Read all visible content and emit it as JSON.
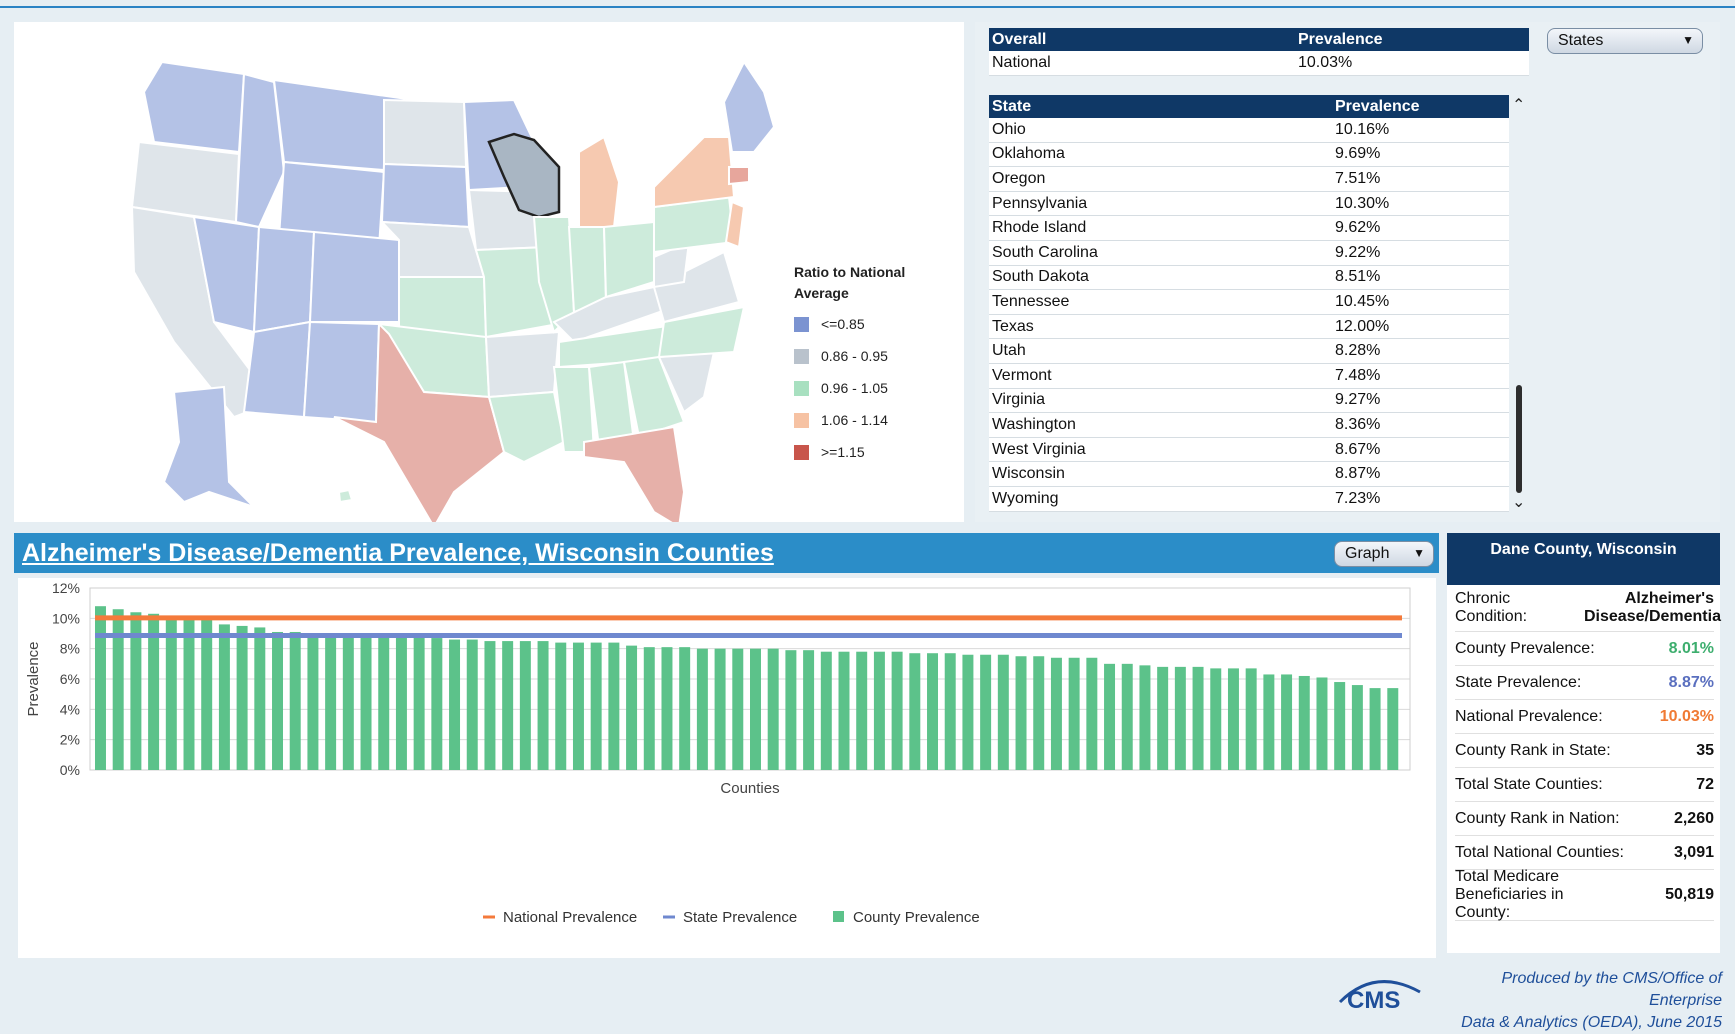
{
  "map": {
    "legend_title_line1": "Ratio to National",
    "legend_title_line2": "Average",
    "legend": [
      {
        "label": "<=0.85",
        "color": "#7b93d1"
      },
      {
        "label": "0.86 - 0.95",
        "color": "#b9c2cc"
      },
      {
        "label": "0.96 - 1.05",
        "color": "#a8e0c0"
      },
      {
        "label": "1.06 - 1.14",
        "color": "#f6c2a3"
      },
      {
        "label": ">=1.15",
        "color": "#c8554b"
      }
    ]
  },
  "overall_table": {
    "col1": "Overall",
    "col2": "Prevalence",
    "row_label": "National",
    "row_value": "10.03%"
  },
  "states_dropdown": "States",
  "state_table": {
    "col1": "State",
    "col2": "Prevalence",
    "rows": [
      {
        "state": "Ohio",
        "value": "10.16%"
      },
      {
        "state": "Oklahoma",
        "value": "9.69%"
      },
      {
        "state": "Oregon",
        "value": "7.51%"
      },
      {
        "state": "Pennsylvania",
        "value": "10.30%"
      },
      {
        "state": "Rhode Island",
        "value": "9.62%"
      },
      {
        "state": "South Carolina",
        "value": "9.22%"
      },
      {
        "state": "South Dakota",
        "value": "8.51%"
      },
      {
        "state": "Tennessee",
        "value": "10.45%"
      },
      {
        "state": "Texas",
        "value": "12.00%"
      },
      {
        "state": "Utah",
        "value": "8.28%"
      },
      {
        "state": "Vermont",
        "value": "7.48%"
      },
      {
        "state": "Virginia",
        "value": "9.27%"
      },
      {
        "state": "Washington",
        "value": "8.36%"
      },
      {
        "state": "West Virginia",
        "value": "8.67%"
      },
      {
        "state": "Wisconsin",
        "value": "8.87%"
      },
      {
        "state": "Wyoming",
        "value": "7.23%"
      }
    ]
  },
  "chart_header": {
    "title": "Alzheimer's Disease/Dementia Prevalence, Wisconsin Counties",
    "graph_dropdown": "Graph"
  },
  "chart_data": {
    "type": "bar",
    "xlabel": "Counties",
    "ylabel": "Prevalence",
    "ylim": [
      0,
      12
    ],
    "yticks": [
      "0%",
      "2%",
      "4%",
      "6%",
      "8%",
      "10%",
      "12%"
    ],
    "grid": true,
    "legend_position": "bottom",
    "series": [
      {
        "name": "County Prevalence",
        "type": "bar",
        "color": "#5cc28a",
        "values": [
          10.8,
          10.6,
          10.4,
          10.3,
          10.0,
          9.9,
          9.9,
          9.6,
          9.5,
          9.4,
          9.1,
          9.1,
          9.0,
          8.9,
          8.9,
          8.9,
          8.8,
          8.8,
          8.8,
          8.7,
          8.6,
          8.6,
          8.5,
          8.5,
          8.5,
          8.5,
          8.4,
          8.4,
          8.4,
          8.4,
          8.2,
          8.1,
          8.1,
          8.1,
          8.0,
          8.0,
          8.0,
          8.0,
          8.0,
          7.9,
          7.9,
          7.8,
          7.8,
          7.8,
          7.8,
          7.8,
          7.7,
          7.7,
          7.7,
          7.6,
          7.6,
          7.6,
          7.5,
          7.5,
          7.4,
          7.4,
          7.4,
          7.0,
          7.0,
          6.9,
          6.8,
          6.8,
          6.8,
          6.7,
          6.7,
          6.7,
          6.3,
          6.3,
          6.2,
          6.1,
          5.8,
          5.6,
          5.4,
          5.4
        ]
      },
      {
        "name": "National Prevalence",
        "type": "line",
        "color": "#f47a3b",
        "value": 10.03
      },
      {
        "name": "State Prevalence",
        "type": "line",
        "color": "#6f88cf",
        "value": 8.87
      }
    ]
  },
  "county_info": {
    "title": "Dane County, Wisconsin",
    "rows": [
      {
        "label": "Chronic Condition:",
        "value": "Alzheimer's Disease/Dementia",
        "color": "#111111"
      },
      {
        "label": "County Prevalence:",
        "value": "8.01%",
        "color": "#3dae6e"
      },
      {
        "label": "State Prevalence:",
        "value": "8.87%",
        "color": "#5a6fbf"
      },
      {
        "label": "National Prevalence:",
        "value": "10.03%",
        "color": "#f07a34"
      },
      {
        "label": "County Rank in State:",
        "value": "35",
        "color": "#111111"
      },
      {
        "label": "Total State Counties:",
        "value": "72",
        "color": "#111111"
      },
      {
        "label": "County Rank in Nation:",
        "value": "2,260",
        "color": "#111111"
      },
      {
        "label": "Total National Counties:",
        "value": "3,091",
        "color": "#111111"
      },
      {
        "label": "Total Medicare Beneficiaries in County:",
        "value": "50,819",
        "color": "#111111"
      }
    ]
  },
  "footer": {
    "credit_line1": "Produced by the CMS/Office of Enterprise",
    "credit_line2": "Data & Analytics (OEDA), June 2015",
    "logo_text": "CMS"
  }
}
